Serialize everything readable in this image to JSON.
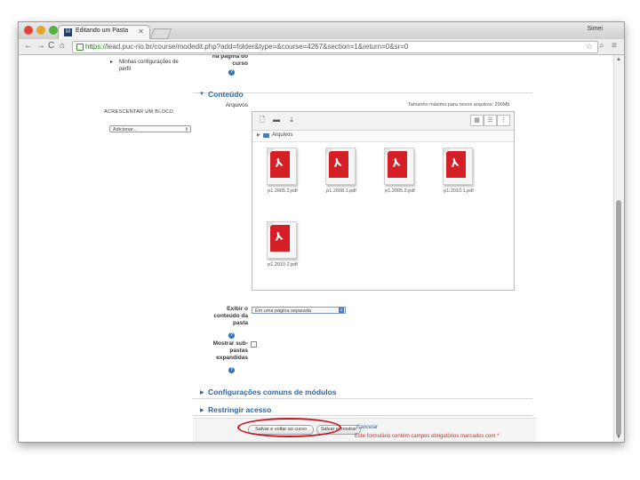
{
  "browser": {
    "tab_title": "Editando um Pasta",
    "tab_favicon": "M",
    "user_name": "Simei",
    "url_scheme": "https://",
    "url_rest": "lead.puc-rio.br/course/modedit.php?add=folder&type=&course=4267&section=1&return=0&sr=0"
  },
  "sidebar": {
    "profile_link": "Minhas configurações de perfil",
    "add_block_heading": "ACRESCENTAR UM BLOCO",
    "add_block_select": "Adicionar..."
  },
  "form": {
    "top_label_fragment": "na página do curso",
    "content_heading": "Conteúdo",
    "files_label": "Arquivos",
    "max_size": "Tamanho máximo para novos arquivos: 200Mb",
    "folder_path": "Arquivos",
    "files": [
      {
        "name": "p1.2005.2.pdf"
      },
      {
        "name": "p1.2008.1.pdf"
      },
      {
        "name": "p1.2005.2.pdf"
      },
      {
        "name": "p1.2010.1.pdf"
      },
      {
        "name": "p1.2010.2.pdf"
      }
    ],
    "display_label": "Exibir o conteúdo da pasta",
    "display_value": "Em uma página separada",
    "show_sub_label": "Mostrar sub-pastas expandidas",
    "common_settings_heading": "Configurações comuns de módulos",
    "restrict_heading": "Restringir acesso",
    "save_return_button": "Salvar e voltar ao curso",
    "save_show_button": "Salvar e mostrar",
    "cancel_link": "Cancelar",
    "required_note": "Este formulário contém campos obrigatórios marcados com *"
  },
  "colors": {
    "accent_blue": "#2d65a6",
    "highlight_red": "#c4161c",
    "pdf_red": "#d51f26"
  }
}
